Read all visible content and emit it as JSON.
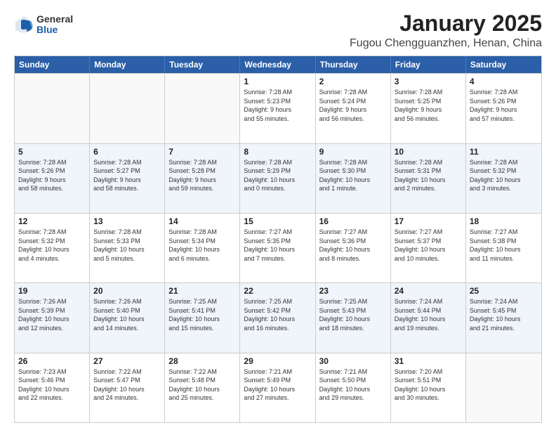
{
  "header": {
    "logo_general": "General",
    "logo_blue": "Blue",
    "month_title": "January 2025",
    "location": "Fugou Chengguanzhen, Henan, China"
  },
  "days_of_week": [
    "Sunday",
    "Monday",
    "Tuesday",
    "Wednesday",
    "Thursday",
    "Friday",
    "Saturday"
  ],
  "weeks": [
    {
      "days": [
        {
          "num": "",
          "info": ""
        },
        {
          "num": "",
          "info": ""
        },
        {
          "num": "",
          "info": ""
        },
        {
          "num": "1",
          "info": "Sunrise: 7:28 AM\nSunset: 5:23 PM\nDaylight: 9 hours\nand 55 minutes."
        },
        {
          "num": "2",
          "info": "Sunrise: 7:28 AM\nSunset: 5:24 PM\nDaylight: 9 hours\nand 56 minutes."
        },
        {
          "num": "3",
          "info": "Sunrise: 7:28 AM\nSunset: 5:25 PM\nDaylight: 9 hours\nand 56 minutes."
        },
        {
          "num": "4",
          "info": "Sunrise: 7:28 AM\nSunset: 5:26 PM\nDaylight: 9 hours\nand 57 minutes."
        }
      ]
    },
    {
      "days": [
        {
          "num": "5",
          "info": "Sunrise: 7:28 AM\nSunset: 5:26 PM\nDaylight: 9 hours\nand 58 minutes."
        },
        {
          "num": "6",
          "info": "Sunrise: 7:28 AM\nSunset: 5:27 PM\nDaylight: 9 hours\nand 58 minutes."
        },
        {
          "num": "7",
          "info": "Sunrise: 7:28 AM\nSunset: 5:28 PM\nDaylight: 9 hours\nand 59 minutes."
        },
        {
          "num": "8",
          "info": "Sunrise: 7:28 AM\nSunset: 5:29 PM\nDaylight: 10 hours\nand 0 minutes."
        },
        {
          "num": "9",
          "info": "Sunrise: 7:28 AM\nSunset: 5:30 PM\nDaylight: 10 hours\nand 1 minute."
        },
        {
          "num": "10",
          "info": "Sunrise: 7:28 AM\nSunset: 5:31 PM\nDaylight: 10 hours\nand 2 minutes."
        },
        {
          "num": "11",
          "info": "Sunrise: 7:28 AM\nSunset: 5:32 PM\nDaylight: 10 hours\nand 3 minutes."
        }
      ]
    },
    {
      "days": [
        {
          "num": "12",
          "info": "Sunrise: 7:28 AM\nSunset: 5:32 PM\nDaylight: 10 hours\nand 4 minutes."
        },
        {
          "num": "13",
          "info": "Sunrise: 7:28 AM\nSunset: 5:33 PM\nDaylight: 10 hours\nand 5 minutes."
        },
        {
          "num": "14",
          "info": "Sunrise: 7:28 AM\nSunset: 5:34 PM\nDaylight: 10 hours\nand 6 minutes."
        },
        {
          "num": "15",
          "info": "Sunrise: 7:27 AM\nSunset: 5:35 PM\nDaylight: 10 hours\nand 7 minutes."
        },
        {
          "num": "16",
          "info": "Sunrise: 7:27 AM\nSunset: 5:36 PM\nDaylight: 10 hours\nand 8 minutes."
        },
        {
          "num": "17",
          "info": "Sunrise: 7:27 AM\nSunset: 5:37 PM\nDaylight: 10 hours\nand 10 minutes."
        },
        {
          "num": "18",
          "info": "Sunrise: 7:27 AM\nSunset: 5:38 PM\nDaylight: 10 hours\nand 11 minutes."
        }
      ]
    },
    {
      "days": [
        {
          "num": "19",
          "info": "Sunrise: 7:26 AM\nSunset: 5:39 PM\nDaylight: 10 hours\nand 12 minutes."
        },
        {
          "num": "20",
          "info": "Sunrise: 7:26 AM\nSunset: 5:40 PM\nDaylight: 10 hours\nand 14 minutes."
        },
        {
          "num": "21",
          "info": "Sunrise: 7:25 AM\nSunset: 5:41 PM\nDaylight: 10 hours\nand 15 minutes."
        },
        {
          "num": "22",
          "info": "Sunrise: 7:25 AM\nSunset: 5:42 PM\nDaylight: 10 hours\nand 16 minutes."
        },
        {
          "num": "23",
          "info": "Sunrise: 7:25 AM\nSunset: 5:43 PM\nDaylight: 10 hours\nand 18 minutes."
        },
        {
          "num": "24",
          "info": "Sunrise: 7:24 AM\nSunset: 5:44 PM\nDaylight: 10 hours\nand 19 minutes."
        },
        {
          "num": "25",
          "info": "Sunrise: 7:24 AM\nSunset: 5:45 PM\nDaylight: 10 hours\nand 21 minutes."
        }
      ]
    },
    {
      "days": [
        {
          "num": "26",
          "info": "Sunrise: 7:23 AM\nSunset: 5:46 PM\nDaylight: 10 hours\nand 22 minutes."
        },
        {
          "num": "27",
          "info": "Sunrise: 7:22 AM\nSunset: 5:47 PM\nDaylight: 10 hours\nand 24 minutes."
        },
        {
          "num": "28",
          "info": "Sunrise: 7:22 AM\nSunset: 5:48 PM\nDaylight: 10 hours\nand 25 minutes."
        },
        {
          "num": "29",
          "info": "Sunrise: 7:21 AM\nSunset: 5:49 PM\nDaylight: 10 hours\nand 27 minutes."
        },
        {
          "num": "30",
          "info": "Sunrise: 7:21 AM\nSunset: 5:50 PM\nDaylight: 10 hours\nand 29 minutes."
        },
        {
          "num": "31",
          "info": "Sunrise: 7:20 AM\nSunset: 5:51 PM\nDaylight: 10 hours\nand 30 minutes."
        },
        {
          "num": "",
          "info": ""
        }
      ]
    }
  ]
}
